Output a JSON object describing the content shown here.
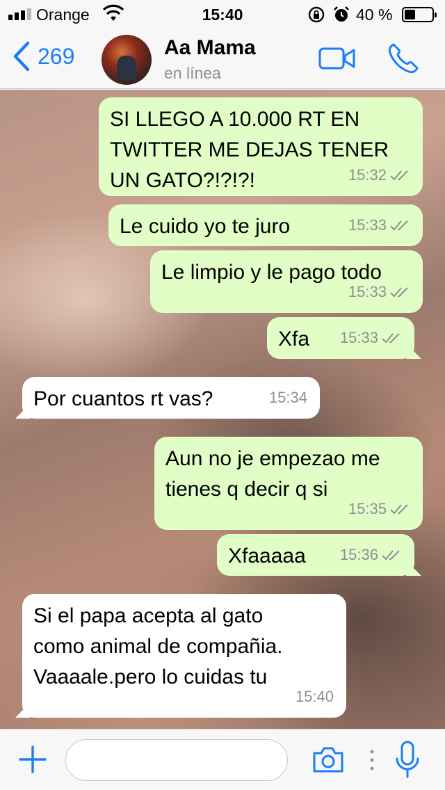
{
  "status_bar": {
    "carrier": "Orange",
    "time": "15:40",
    "battery_percent_text": "40 %",
    "battery_level": 0.4,
    "icons": [
      "signal-icon",
      "wifi-icon",
      "orientation-lock-icon",
      "alarm-icon",
      "battery-icon"
    ]
  },
  "nav": {
    "back_count": "269",
    "contact_name": "Aa Mama",
    "contact_status": "en línea",
    "icons": [
      "chevron-left-icon",
      "video-call-icon",
      "phone-icon"
    ]
  },
  "messages": [
    {
      "direction": "sent",
      "text": "SI LLEGO A 10.000 RT EN\nTWITTER ME DEJAS TENER\nUN GATO?!?!?!",
      "time": "15:32",
      "read": true
    },
    {
      "direction": "sent",
      "text": "Le cuido yo te juro",
      "time": "15:33",
      "read": true
    },
    {
      "direction": "sent",
      "text": "Le limpio y le pago todo",
      "time": "15:33",
      "read": true
    },
    {
      "direction": "sent",
      "text": "Xfa",
      "time": "15:33",
      "read": true
    },
    {
      "direction": "received",
      "text": "Por cuantos rt vas?",
      "time": "15:34"
    },
    {
      "direction": "sent",
      "text": "Aun no je empezao me\ntienes q decir q si",
      "time": "15:35",
      "read": true
    },
    {
      "direction": "sent",
      "text": "Xfaaaaa",
      "time": "15:36",
      "read": true
    },
    {
      "direction": "received",
      "text": "Si el papa acepta al gato\ncomo animal de compañia.\nVaaaale.pero lo cuidas tu",
      "time": "15:40"
    }
  ],
  "input_bar": {
    "placeholder": "",
    "value": "",
    "icons": [
      "plus-icon",
      "camera-icon",
      "more-icon",
      "microphone-icon"
    ]
  },
  "colors": {
    "accent": "#1a7ef7",
    "sent_bubble": "#e1fec6",
    "received_bubble": "#ffffff",
    "read_ticks": "#8e8e93"
  }
}
